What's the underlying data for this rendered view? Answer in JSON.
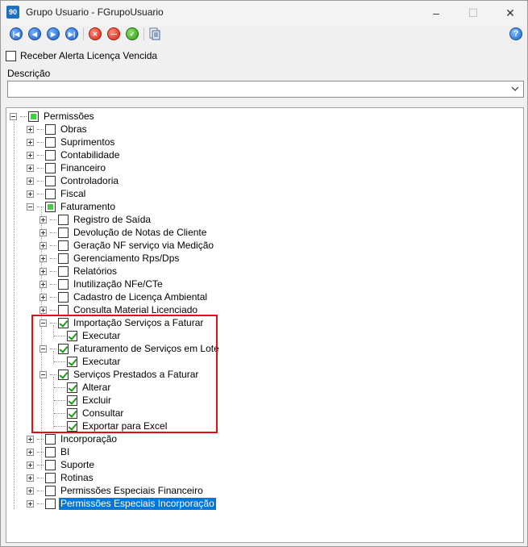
{
  "window": {
    "title": "Grupo Usuario - FGrupoUsuario",
    "app_icon_text": "90"
  },
  "toolbar": {
    "buttons": [
      {
        "name": "first-record-icon",
        "glyph": "|◀"
      },
      {
        "name": "previous-record-icon",
        "glyph": "◀"
      },
      {
        "name": "next-record-icon",
        "glyph": "▶"
      },
      {
        "name": "last-record-icon",
        "glyph": "▶|"
      },
      {
        "name": "cancel-icon",
        "glyph": "✕"
      },
      {
        "name": "delete-icon",
        "glyph": "—"
      },
      {
        "name": "confirm-icon",
        "glyph": "✓"
      }
    ],
    "help_glyph": "?"
  },
  "alert_checkbox": {
    "label": "Receber Alerta Licença Vencida",
    "checked": false
  },
  "descricao": {
    "label": "Descrição",
    "value": ""
  },
  "tree": {
    "root": "Permissões",
    "nodes": [
      {
        "label": "Obras",
        "state": "unchecked",
        "level": 1
      },
      {
        "label": "Suprimentos",
        "state": "unchecked",
        "level": 1
      },
      {
        "label": "Contabilidade",
        "state": "unchecked",
        "level": 1
      },
      {
        "label": "Financeiro",
        "state": "unchecked",
        "level": 1
      },
      {
        "label": "Controladoria",
        "state": "unchecked",
        "level": 1
      },
      {
        "label": "Fiscal",
        "state": "unchecked",
        "level": 1
      },
      {
        "label": "Faturamento",
        "state": "partial",
        "level": 1,
        "expanded": true
      },
      {
        "label": "Registro de Saída",
        "state": "unchecked",
        "level": 2
      },
      {
        "label": "Devolução de Notas de Cliente",
        "state": "unchecked",
        "level": 2
      },
      {
        "label": "Geração NF serviço via Medição",
        "state": "unchecked",
        "level": 2
      },
      {
        "label": "Gerenciamento Rps/Dps",
        "state": "unchecked",
        "level": 2
      },
      {
        "label": "Relatórios",
        "state": "unchecked",
        "level": 2
      },
      {
        "label": "Inutilização NFe/CTe",
        "state": "unchecked",
        "level": 2
      },
      {
        "label": "Cadastro de Licença Ambiental",
        "state": "unchecked",
        "level": 2
      },
      {
        "label": "Consulta Material Licenciado",
        "state": "unchecked",
        "level": 2
      },
      {
        "label": "Importação Serviços a Faturar",
        "state": "checked",
        "level": 2,
        "expanded": true
      },
      {
        "label": "Executar",
        "state": "checked",
        "level": 3
      },
      {
        "label": "Faturamento de Serviços em Lote",
        "state": "checked",
        "level": 2,
        "expanded": true
      },
      {
        "label": "Executar",
        "state": "checked",
        "level": 3
      },
      {
        "label": "Serviços Prestados a Faturar",
        "state": "checked",
        "level": 2,
        "expanded": true
      },
      {
        "label": "Alterar",
        "state": "checked",
        "level": 3
      },
      {
        "label": "Excluir",
        "state": "checked",
        "level": 3
      },
      {
        "label": "Consultar",
        "state": "checked",
        "level": 3
      },
      {
        "label": "Exportar para Excel",
        "state": "checked",
        "level": 3
      },
      {
        "label": "Incorporação",
        "state": "unchecked",
        "level": 1
      },
      {
        "label": "BI",
        "state": "unchecked",
        "level": 1
      },
      {
        "label": "Suporte",
        "state": "unchecked",
        "level": 1
      },
      {
        "label": "Rotinas",
        "state": "unchecked",
        "level": 1
      },
      {
        "label": "Permissões Especiais Financeiro",
        "state": "unchecked",
        "level": 1
      },
      {
        "label": "Permissões Especiais Incorporação",
        "state": "unchecked",
        "level": 1,
        "selected": true
      }
    ]
  },
  "colors": {
    "selection": "#0078d7",
    "highlight_box": "#e01010",
    "check_green": "#1a9c1a",
    "partial_green": "#3ed13e"
  }
}
